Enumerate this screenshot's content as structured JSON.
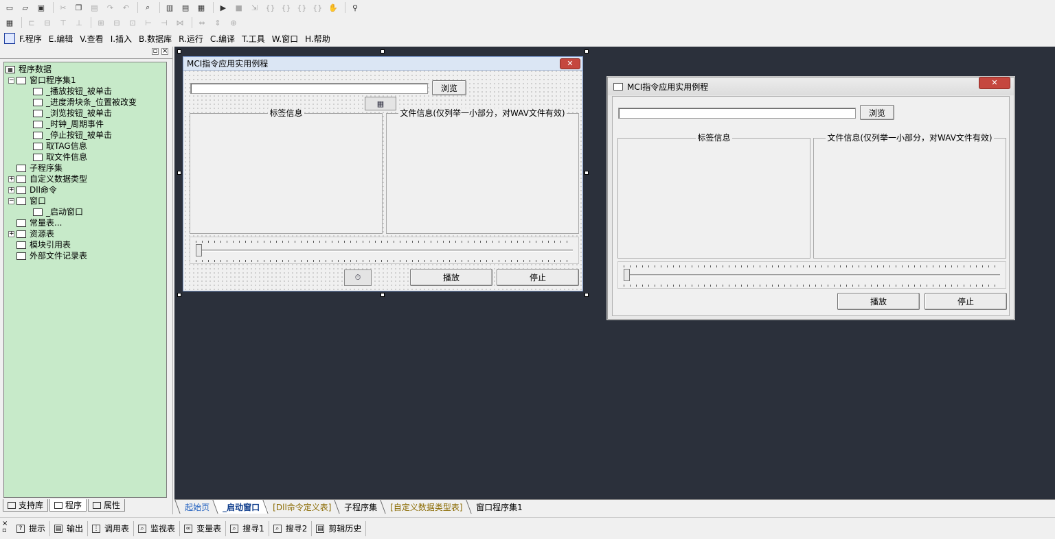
{
  "menubar": {
    "items": [
      "F.程序",
      "E.编辑",
      "V.查看",
      "I.插入",
      "B.数据库",
      "R.运行",
      "C.编译",
      "T.工具",
      "W.窗口",
      "H.帮助"
    ]
  },
  "tree": {
    "root": "程序数据",
    "items": [
      {
        "label": "窗口程序集1",
        "level": 1,
        "expander": "−"
      },
      {
        "label": "_播放按钮_被单击",
        "level": 2
      },
      {
        "label": "_进度滑块条_位置被改变",
        "level": 2
      },
      {
        "label": "_浏览按钮_被单击",
        "level": 2
      },
      {
        "label": "_时钟_周期事件",
        "level": 2
      },
      {
        "label": "_停止按钮_被单击",
        "level": 2
      },
      {
        "label": "取TAG信息",
        "level": 2
      },
      {
        "label": "取文件信息",
        "level": 2
      },
      {
        "label": "子程序集",
        "level": 1
      },
      {
        "label": "自定义数据类型",
        "level": 1,
        "expander": "+"
      },
      {
        "label": "Dll命令",
        "level": 1,
        "expander": "+"
      },
      {
        "label": "窗口",
        "level": 1,
        "expander": "−"
      },
      {
        "label": "_启动窗口",
        "level": 2
      },
      {
        "label": "常量表...",
        "level": 1
      },
      {
        "label": "资源表",
        "level": 1,
        "expander": "+"
      },
      {
        "label": "模块引用表",
        "level": 1
      },
      {
        "label": "外部文件记录表",
        "level": 1
      }
    ]
  },
  "sidebar_tabs": [
    "支持库",
    "程序",
    "属性"
  ],
  "design_window": {
    "title": "MCI指令应用实用例程",
    "close": "✕",
    "browse": "浏览",
    "tag_group": "标签信息",
    "file_group": "文件信息(仅列举一小部分，对WAV文件有效)",
    "play": "播放",
    "stop": "停止"
  },
  "preview_window": {
    "title": "MCI指令应用实用例程",
    "close": "✕",
    "browse": "浏览",
    "tag_group": "标签信息",
    "file_group": "文件信息(仅列举一小部分，对WAV文件有效)",
    "play": "播放",
    "stop": "停止"
  },
  "doc_tabs": [
    "起始页",
    "_启动窗口",
    "[Dll命令定义表]",
    "子程序集",
    "[自定义数据类型表]",
    "窗口程序集1"
  ],
  "doc_tab_active": "_启动窗口",
  "bottom_bar": [
    "提示",
    "输出",
    "调用表",
    "监视表",
    "变量表",
    "搜寻1",
    "搜寻2",
    "剪辑历史"
  ],
  "slider": {
    "design_position": 0.0,
    "preview_position": 0.0
  },
  "colors": {
    "tree_background": "#c7eac9",
    "workarea": "#2b303b",
    "close_button": "#c5473f",
    "doc_tab_link": "#1f5fbf",
    "doc_tab_dll": "#8a6a00"
  }
}
